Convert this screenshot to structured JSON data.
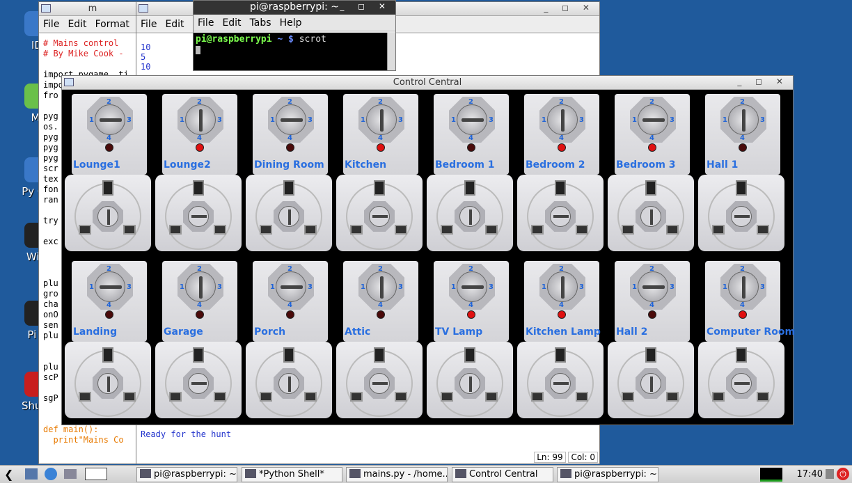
{
  "desktop": {
    "icons": [
      {
        "label": "ID",
        "color": "#3a78c8"
      },
      {
        "label": "Mi",
        "color": "#6ac04a"
      },
      {
        "label": "Py Ga",
        "color": "#3a78c8"
      },
      {
        "label": "WiFi",
        "color": "#222222"
      },
      {
        "label": "Pi S",
        "color": "#222222"
      },
      {
        "label": "Shutd",
        "color": "#c81e1e"
      }
    ]
  },
  "editor": {
    "title": "m",
    "menu": [
      "File",
      "Edit",
      "Format"
    ],
    "lines": [
      "# Mains control",
      "# By Mike Cook -",
      "",
      "import pygame, ti",
      "impo",
      "fro",
      "",
      "pyg",
      "os.",
      "pyg",
      "pyg",
      "pyg",
      "scr",
      "tex",
      "fon",
      "ran",
      "",
      "try",
      "",
      "exc",
      "",
      "",
      "",
      "plu",
      "gro",
      "cha",
      "onO",
      "sen",
      "plu",
      "",
      "",
      "plu",
      "scP",
      "",
      "sgP",
      "",
      "",
      "def main():",
      "  print\"Mains Co"
    ]
  },
  "shell": {
    "menu": [
      "File",
      "Edit",
      "S"
    ],
    "output_top": [
      "10",
      "5",
      "10"
    ],
    "output_bottom": "Ready for the hunt",
    "status_ln": "Ln: 99",
    "status_col": "Col: 0"
  },
  "terminal": {
    "title": "pi@raspberrypi: ~",
    "menu": [
      "File",
      "Edit",
      "Tabs",
      "Help"
    ],
    "prompt_user": "pi@raspberrypi",
    "prompt_path": "~ $",
    "command": "scrot"
  },
  "control": {
    "title": "Control Central",
    "plugs": [
      {
        "name": "Lounge1",
        "on": false,
        "knob": "h"
      },
      {
        "name": "Lounge2",
        "on": true,
        "knob": "v"
      },
      {
        "name": "Dining Room",
        "on": false,
        "knob": "h"
      },
      {
        "name": "Kitchen",
        "on": true,
        "knob": "v"
      },
      {
        "name": "Bedroom 1",
        "on": false,
        "knob": "h"
      },
      {
        "name": "Bedroom 2",
        "on": true,
        "knob": "v"
      },
      {
        "name": "Bedroom 3",
        "on": true,
        "knob": "h"
      },
      {
        "name": "Hall 1",
        "on": false,
        "knob": "v"
      },
      {
        "name": "Landing",
        "on": false,
        "knob": "h"
      },
      {
        "name": "Garage",
        "on": false,
        "knob": "v"
      },
      {
        "name": "Porch",
        "on": false,
        "knob": "h"
      },
      {
        "name": "Attic",
        "on": false,
        "knob": "v"
      },
      {
        "name": "TV Lamp",
        "on": true,
        "knob": "h"
      },
      {
        "name": "Kitchen Lamp",
        "on": true,
        "knob": "v"
      },
      {
        "name": "Hall 2",
        "on": false,
        "knob": "h"
      },
      {
        "name": "Computer Room",
        "on": true,
        "knob": "v"
      }
    ]
  },
  "taskbar": {
    "buttons": [
      "pi@raspberrypi: ~",
      "*Python Shell*",
      "mains.py - /home...",
      "Control Central",
      "pi@raspberrypi: ~"
    ],
    "clock": "17:40"
  }
}
